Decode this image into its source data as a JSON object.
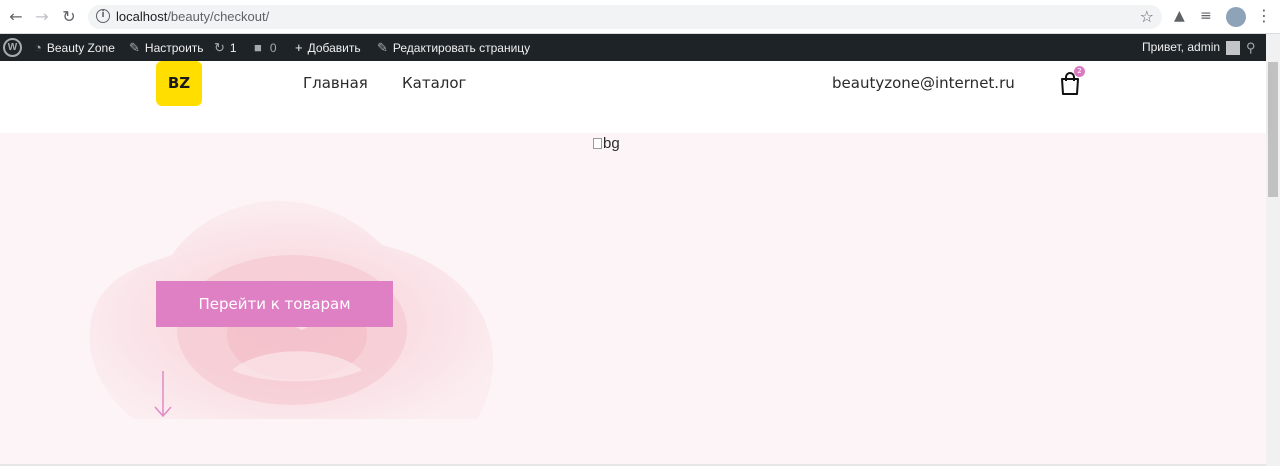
{
  "browser": {
    "url_host": "localhost",
    "url_path": "/beauty/checkout/",
    "back_icon": "arrow-left",
    "forward_icon": "arrow-right",
    "reload_icon": "reload",
    "info_glyph": "i"
  },
  "admin_bar": {
    "site_name": "Beauty Zone",
    "customize": "Настроить",
    "updates_count": "1",
    "comments_count": "0",
    "new_label": "Добавить",
    "edit_label": "Редактировать страницу",
    "greeting": "Привет, admin"
  },
  "header": {
    "logo_text": "BZ",
    "nav": [
      {
        "label": "Главная"
      },
      {
        "label": "Каталог"
      }
    ],
    "email": "beautyzone@internet.ru",
    "cart_count": "2"
  },
  "hero": {
    "image_alt": "bg",
    "cta_label": "Перейти к товарам"
  },
  "colors": {
    "accent": "#df7fc4",
    "logo_bg": "#ffde00",
    "admin_bar_bg": "#1d2327",
    "hero_bg": "#fdf4f8"
  }
}
